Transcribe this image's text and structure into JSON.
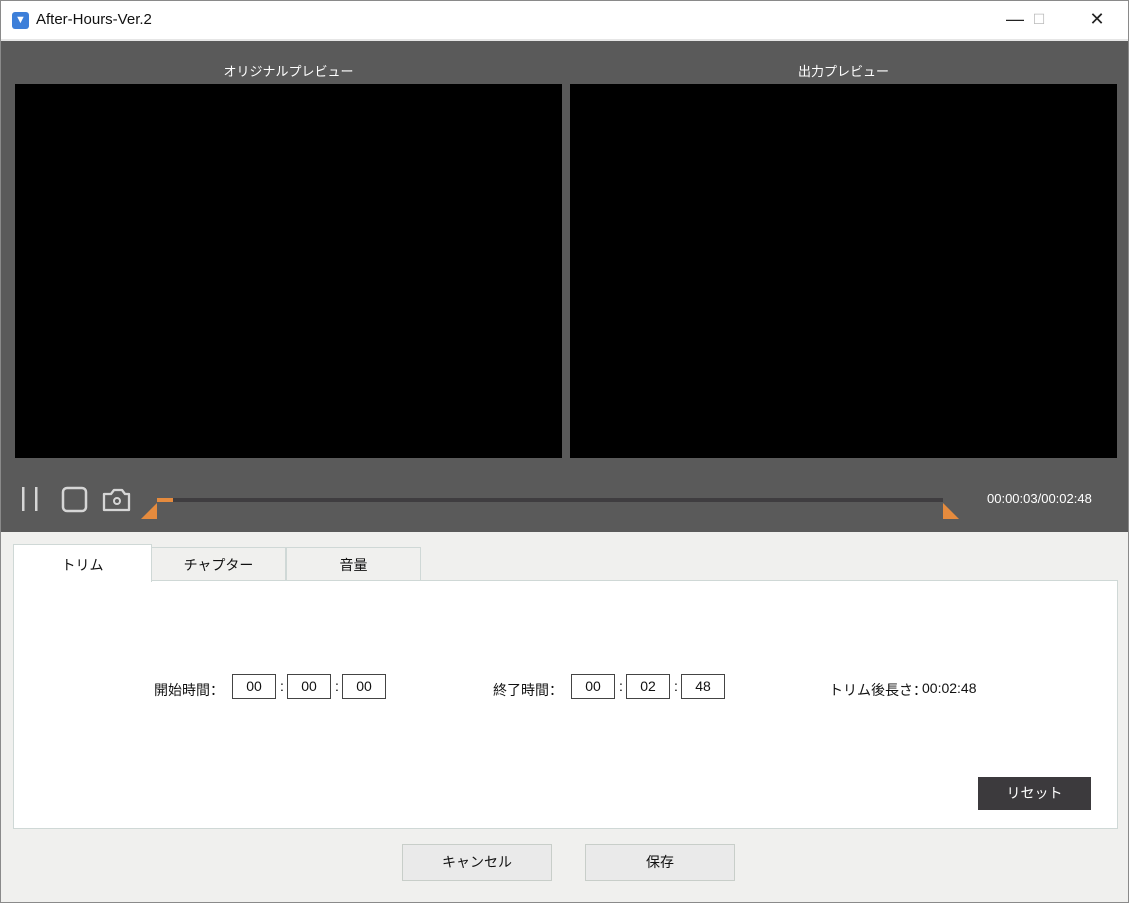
{
  "window": {
    "title": "After-Hours-Ver.2",
    "minimize": "—",
    "maximize": "☐",
    "close": "✕"
  },
  "preview": {
    "original_label": "オリジナルプレビュー",
    "output_label": "出力プレビュー"
  },
  "player": {
    "time": "00:00:03/00:02:48",
    "progress_fraction": 0.018
  },
  "tabs": [
    {
      "label": "トリム"
    },
    {
      "label": "チャプター"
    },
    {
      "label": "音量"
    }
  ],
  "trim": {
    "start_label": "開始時間：",
    "start": [
      "00",
      "00",
      "00"
    ],
    "end_label": "終了時間：",
    "end": [
      "00",
      "02",
      "48"
    ],
    "length_label": "トリム後長さ：",
    "length": "00:02:48",
    "separator": ":",
    "reset": "リセット"
  },
  "footer": {
    "cancel": "キャンセル",
    "save": "保存"
  },
  "colors": {
    "accent": "#e58b3e",
    "dark_bg": "#5a5a5a"
  }
}
